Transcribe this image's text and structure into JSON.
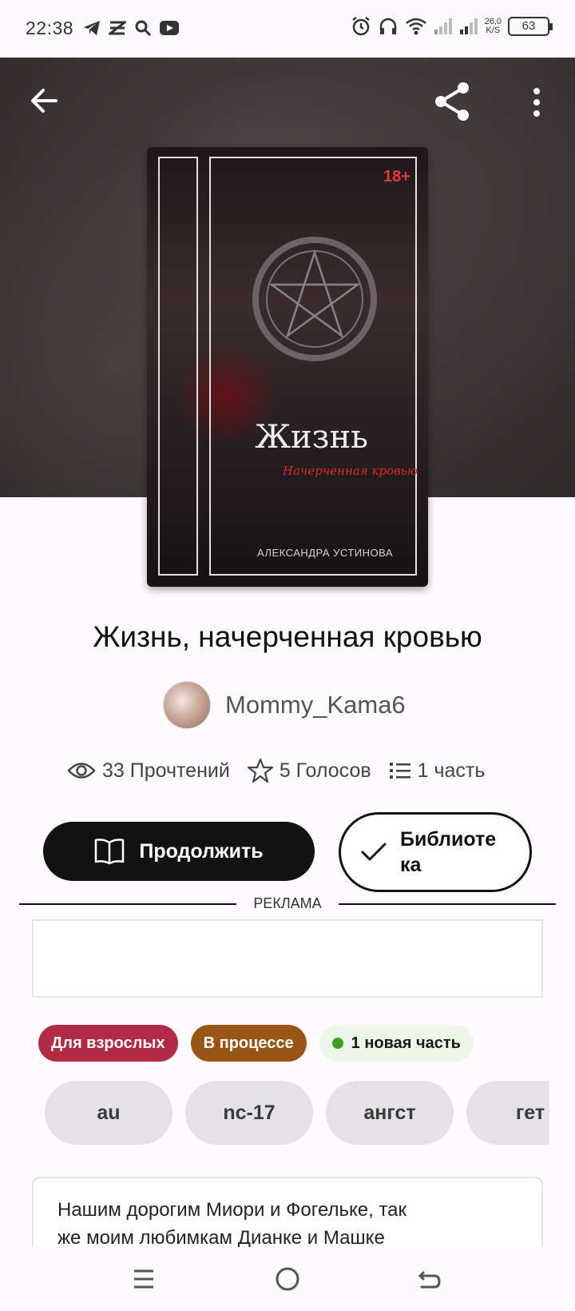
{
  "status_bar": {
    "time": "22:38",
    "speed_value": "26,0",
    "speed_unit": "K/S",
    "battery": "63"
  },
  "header": {
    "back_icon": "arrow-left-icon",
    "share_icon": "share-icon",
    "more_icon": "more-vertical-icon"
  },
  "cover": {
    "age_rating": "18+",
    "title": "Жизнь",
    "subtitle": "Начерченная кровью",
    "author": "АЛЕКСАНДРА УСТИНОВА"
  },
  "book": {
    "title": "Жизнь, начерченная кровью",
    "author_name": "Mommy_Kama6"
  },
  "stats": {
    "reads": "33 Прочтений",
    "votes": "5 Голосов",
    "parts": "1 часть"
  },
  "actions": {
    "continue_label": "Продолжить",
    "library_label": "Библиотека"
  },
  "ad": {
    "label": "РЕКЛАМА"
  },
  "badges": {
    "adult": "Для взрослых",
    "status": "В процессе",
    "new_part": "1 новая часть"
  },
  "tags": [
    "au",
    "nc-17",
    "ангст",
    "гет"
  ],
  "description": {
    "line1": "Нашим дорогим Миори и Фогельке, так",
    "line2": "же моим любимкам Дианке и Машке"
  },
  "colors": {
    "adult_badge": "#b22b45",
    "progress_badge": "#9a5414",
    "new_dot": "#3aa324",
    "primary_button": "#121212"
  }
}
